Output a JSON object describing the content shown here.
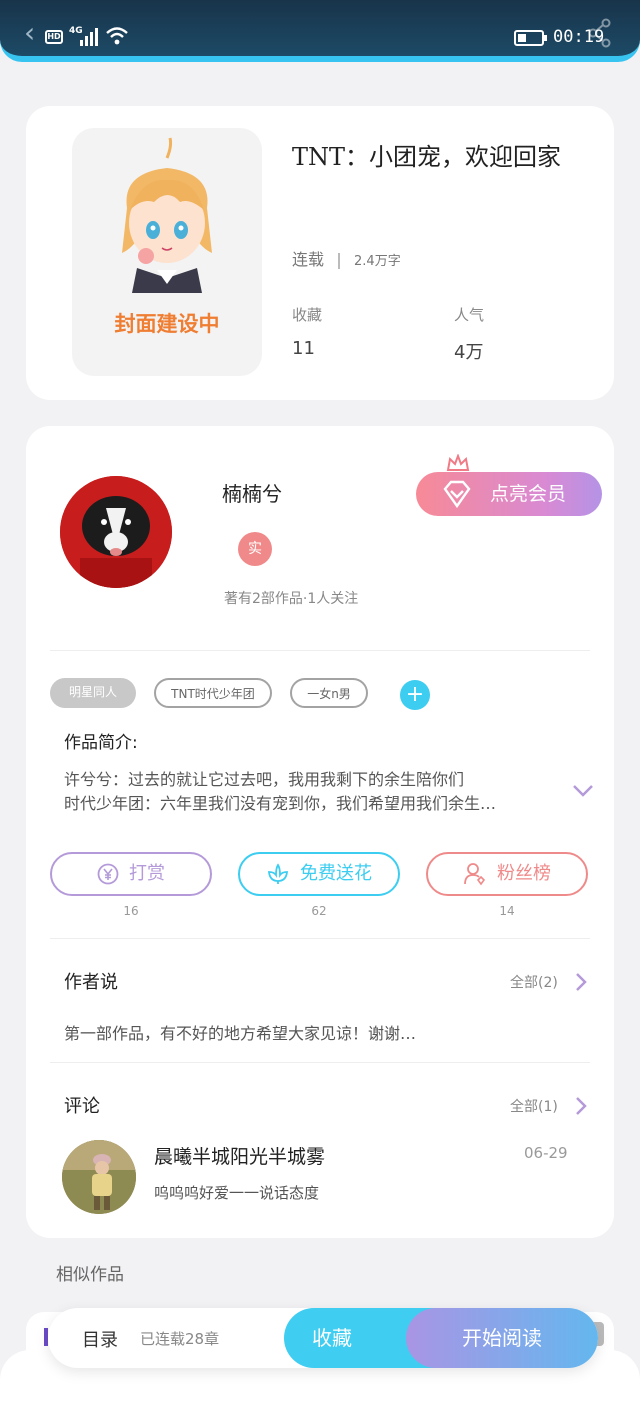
{
  "status_bar": {
    "hd_label": "HD",
    "network_label": "4G",
    "time": "00:19"
  },
  "book": {
    "cover_text": "封面建设中",
    "title": "TNT：小团宠，欢迎回家",
    "status": "连载",
    "word_count": "2.4万字",
    "stats": [
      {
        "label": "收藏",
        "value": "11"
      },
      {
        "label": "人气",
        "value": "4万"
      }
    ]
  },
  "author": {
    "name": "楠楠兮",
    "verified_badge": "实",
    "summary": "著有2部作品·1人关注",
    "vip_button": "点亮会员"
  },
  "tags": [
    "明星同人",
    "TNT时代少年团",
    "一女n男"
  ],
  "intro": {
    "label": "作品简介:",
    "lines": [
      "许兮兮：过去的就让它过去吧，我用我剩下的余生陪你们",
      "时代少年团：六年里我们没有宠到你，我们希望用我们余生…"
    ]
  },
  "actions": [
    {
      "label": "打赏",
      "count": "16",
      "color": "#b49ad9",
      "icon": "yen-icon"
    },
    {
      "label": "免费送花",
      "count": "62",
      "color": "#3ccdf0",
      "icon": "flower-icon"
    },
    {
      "label": "粉丝榜",
      "count": "14",
      "color": "#ef8a8a",
      "icon": "fans-icon"
    }
  ],
  "author_says": {
    "title": "作者说",
    "more": "全部(2)",
    "text": "第一部作品，有不好的地方希望大家见谅！谢谢…"
  },
  "comments": {
    "title": "评论",
    "more": "全部(1)",
    "items": [
      {
        "user": "晨曦半城阳光半城雾",
        "date": "06-29",
        "text": "呜呜呜好爱一一说话态度"
      }
    ]
  },
  "similar_title": "相似作品",
  "bottom_bar": {
    "toc": "目录",
    "serial": "已连载28章",
    "favorite": "收藏",
    "start_reading": "开始阅读"
  },
  "colors": {
    "accent_blue": "#3ccdf0",
    "accent_purple": "#a995e4",
    "vip_pink": "#f78a96",
    "cover_text": "#ef7d32"
  }
}
